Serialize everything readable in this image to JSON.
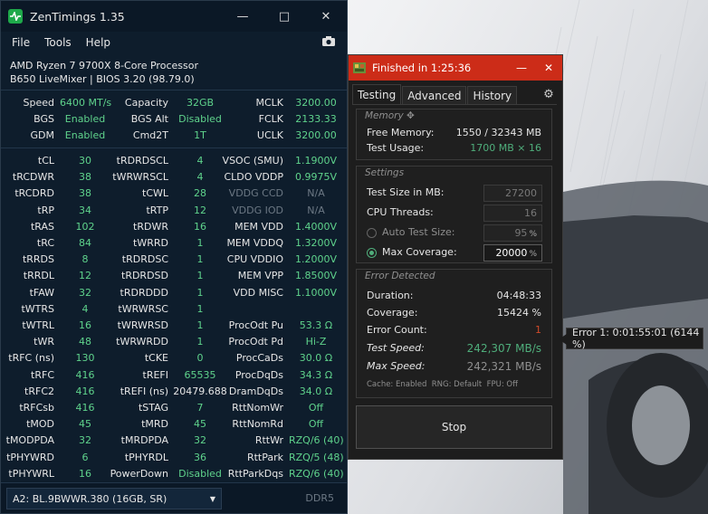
{
  "zentimings": {
    "title": "ZenTimings 1.35",
    "menu": [
      "File",
      "Tools",
      "Help"
    ],
    "cpu": "AMD Ryzen 7 9700X 8-Core Processor",
    "board": "B650 LiveMixer | BIOS 3.20 (98.79.0)",
    "top_rows": [
      [
        "Speed",
        "6400 MT/s",
        "Capacity",
        "32GB",
        "MCLK",
        "3200.00"
      ],
      [
        "BGS",
        "Enabled",
        "BGS Alt",
        "Disabled",
        "FCLK",
        "2133.33"
      ],
      [
        "GDM",
        "Enabled",
        "Cmd2T",
        "1T",
        "UCLK",
        "3200.00"
      ]
    ],
    "timing_rows": [
      [
        "tCL",
        "30",
        "tRDRDSCL",
        "4",
        "VSOC (SMU)",
        "1.1900V"
      ],
      [
        "tRCDWR",
        "38",
        "tWRWRSCL",
        "4",
        "CLDO VDDP",
        "0.9975V"
      ],
      [
        "tRCDRD",
        "38",
        "tCWL",
        "28",
        "VDDG CCD",
        "N/A"
      ],
      [
        "tRP",
        "34",
        "tRTP",
        "12",
        "VDDG IOD",
        "N/A"
      ],
      [
        "tRAS",
        "102",
        "tRDWR",
        "16",
        "MEM VDD",
        "1.4000V"
      ],
      [
        "tRC",
        "84",
        "tWRRD",
        "1",
        "MEM VDDQ",
        "1.3200V"
      ],
      [
        "tRRDS",
        "8",
        "tRDRDSC",
        "1",
        "CPU VDDIO",
        "1.2000V"
      ],
      [
        "tRRDL",
        "12",
        "tRDRDSD",
        "1",
        "MEM VPP",
        "1.8500V"
      ],
      [
        "tFAW",
        "32",
        "tRDRDDD",
        "1",
        "VDD MISC",
        "1.1000V"
      ],
      [
        "tWTRS",
        "4",
        "tWRWRSC",
        "1",
        "",
        ""
      ],
      [
        "tWTRL",
        "16",
        "tWRWRSD",
        "1",
        "ProcOdt Pu",
        "53.3 Ω"
      ],
      [
        "tWR",
        "48",
        "tWRWRDD",
        "1",
        "ProcOdt Pd",
        "Hi-Z"
      ],
      [
        "tRFC (ns)",
        "130",
        "tCKE",
        "0",
        "ProcCaDs",
        "30.0 Ω"
      ],
      [
        "tRFC",
        "416",
        "tREFI",
        "65535",
        "ProcDqDs",
        "34.3 Ω"
      ],
      [
        "tRFC2",
        "416",
        "tREFI (ns)",
        "20479.688",
        "DramDqDs",
        "34.0 Ω"
      ],
      [
        "tRFCsb",
        "416",
        "tSTAG",
        "7",
        "RttNomWr",
        "Off"
      ],
      [
        "tMOD",
        "45",
        "tMRD",
        "45",
        "RttNomRd",
        "Off"
      ],
      [
        "tMODPDA",
        "32",
        "tMRDPDA",
        "32",
        "RttWr",
        "RZQ/6 (40)"
      ],
      [
        "tPHYWRD",
        "6",
        "tPHYRDL",
        "36",
        "RttPark",
        "RZQ/5 (48)"
      ],
      [
        "tPHYWRL",
        "16",
        "PowerDown",
        "Disabled",
        "RttParkDqs",
        "RZQ/6 (40)"
      ]
    ],
    "dimm_select": "A2: BL.9BWWR.380 (16GB, SR)",
    "ddr_type": "DDR5",
    "colors": {
      "value_green": "#5fd38c",
      "bg": "#0e1d2c"
    }
  },
  "testmem": {
    "title": "Finished in 1:25:36",
    "tabs": [
      "Testing",
      "Advanced",
      "History"
    ],
    "memory": {
      "title": "Memory",
      "free_label": "Free Memory:",
      "free_value": "1550 / 32343 MB",
      "usage_label": "Test Usage:",
      "usage_value": "1700 MB × 16"
    },
    "settings": {
      "title": "Settings",
      "size_label": "Test Size in MB:",
      "size_value": "27200",
      "threads_label": "CPU Threads:",
      "threads_value": "16",
      "auto_label": "Auto Test Size:",
      "auto_value": "95",
      "max_label": "Max Coverage:",
      "max_value": "20000",
      "pct": "%"
    },
    "error": {
      "title": "Error Detected",
      "duration_label": "Duration:",
      "duration_value": "04:48:33",
      "coverage_label": "Coverage:",
      "coverage_value": "15424 %",
      "count_label": "Error Count:",
      "count_value": "1",
      "test_speed_label": "Test Speed:",
      "test_speed_value": "242,307 MB/s",
      "max_speed_label": "Max Speed:",
      "max_speed_value": "242,321 MB/s",
      "footer": "Cache: Enabled  RNG: Default  FPU: Off"
    },
    "stop_label": "Stop",
    "colors": {
      "titlebar": "#cc2c18",
      "accent_green": "#4fae7b",
      "error_red": "#d04a2a"
    }
  },
  "tooltip": "Error 1:   0:01:55:01 (6144 %)"
}
